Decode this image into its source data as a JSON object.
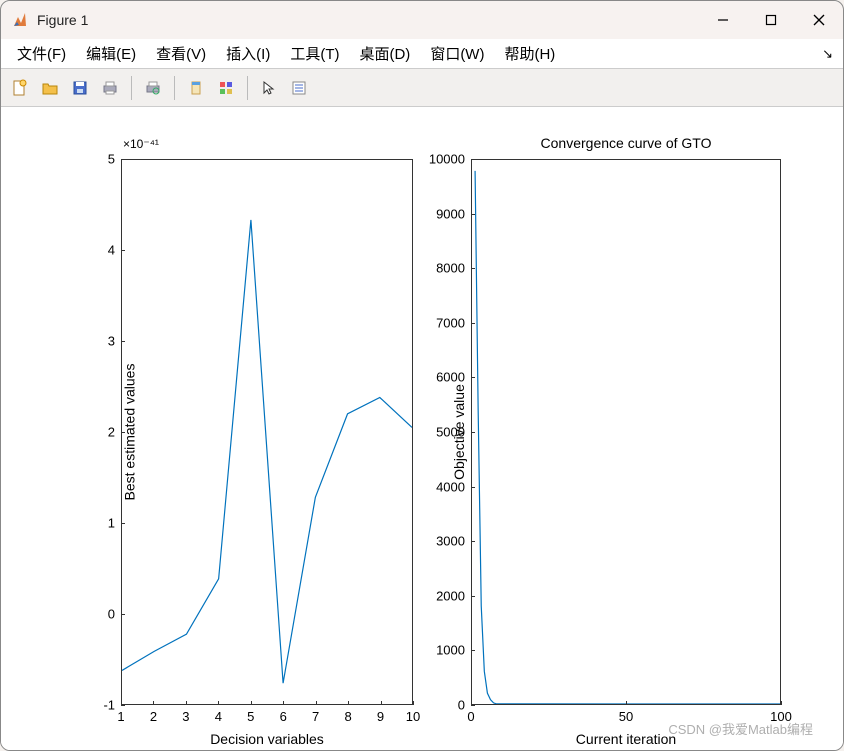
{
  "window": {
    "title": "Figure 1"
  },
  "menubar": {
    "items": [
      "文件(F)",
      "编辑(E)",
      "查看(V)",
      "插入(I)",
      "工具(T)",
      "桌面(D)",
      "窗口(W)",
      "帮助(H)"
    ]
  },
  "toolbar": {
    "icons": [
      "new-file-icon",
      "open-folder-icon",
      "save-icon",
      "print-icon",
      "print-preview-icon",
      "brush-icon",
      "colorgrid-icon",
      "cursor-icon",
      "list-icon"
    ]
  },
  "watermark": "CSDN @我爱Matlab编程",
  "chart_data": [
    {
      "type": "line",
      "position": "left",
      "title": "",
      "xlabel": "Decision variables",
      "ylabel": "Best estimated values",
      "exponent_label": "×10⁻⁴¹",
      "xlim": [
        1,
        10
      ],
      "ylim": [
        -1,
        5
      ],
      "xticks": [
        1,
        2,
        3,
        4,
        5,
        6,
        7,
        8,
        9,
        10
      ],
      "yticks": [
        -1,
        0,
        1,
        2,
        3,
        4,
        5
      ],
      "x": [
        1,
        2,
        3,
        4,
        5,
        6,
        7,
        8,
        9,
        10
      ],
      "values": [
        -0.63,
        -0.42,
        -0.23,
        0.38,
        4.34,
        -0.77,
        1.28,
        2.2,
        2.38,
        2.05
      ]
    },
    {
      "type": "line",
      "position": "right",
      "title": "Convergence curve of GTO",
      "xlabel": "Current iteration",
      "ylabel": "Objective value",
      "xlim": [
        0,
        100
      ],
      "ylim": [
        0,
        10000
      ],
      "xticks": [
        0,
        50,
        100
      ],
      "yticks": [
        0,
        1000,
        2000,
        3000,
        4000,
        5000,
        6000,
        7000,
        8000,
        9000,
        10000
      ],
      "x": [
        1,
        2,
        3,
        4,
        5,
        6,
        7,
        8,
        100
      ],
      "values": [
        9800,
        5400,
        1800,
        600,
        200,
        80,
        20,
        1,
        0.5
      ]
    }
  ],
  "colors": {
    "line": "#0072BD"
  }
}
